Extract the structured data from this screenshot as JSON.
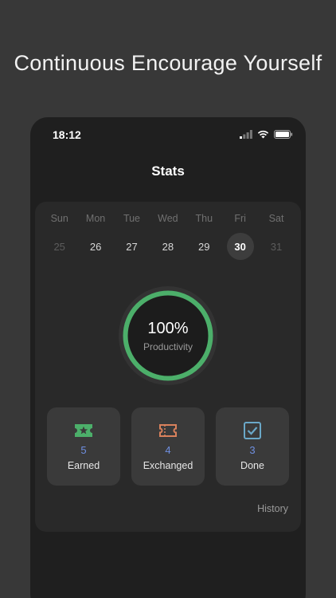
{
  "headline": "Continuous Encourage Yourself",
  "status_bar": {
    "time": "18:12"
  },
  "screen": {
    "title": "Stats"
  },
  "week": [
    {
      "name": "Sun",
      "date": "25",
      "dim": true
    },
    {
      "name": "Mon",
      "date": "26",
      "dim": false
    },
    {
      "name": "Tue",
      "date": "27",
      "dim": false
    },
    {
      "name": "Wed",
      "date": "28",
      "dim": false
    },
    {
      "name": "Thu",
      "date": "29",
      "dim": false
    },
    {
      "name": "Fri",
      "date": "30",
      "selected": true
    },
    {
      "name": "Sat",
      "date": "31",
      "dim": true
    }
  ],
  "productivity": {
    "value": "100%",
    "label": "Productivity",
    "fraction": 1.0,
    "color": "#4caf6a"
  },
  "tiles": [
    {
      "icon": "star-ticket-icon",
      "count": "5",
      "label": "Earned",
      "icon_color": "#4caf6a",
      "count_color": "#6f8fe0"
    },
    {
      "icon": "exchange-ticket-icon",
      "count": "4",
      "label": "Exchanged",
      "icon_color": "#d9815c",
      "count_color": "#6f8fe0"
    },
    {
      "icon": "checkbox-icon",
      "count": "3",
      "label": "Done",
      "icon_color": "#6aa8c8",
      "count_color": "#6f8fe0"
    }
  ],
  "history_label": "History"
}
